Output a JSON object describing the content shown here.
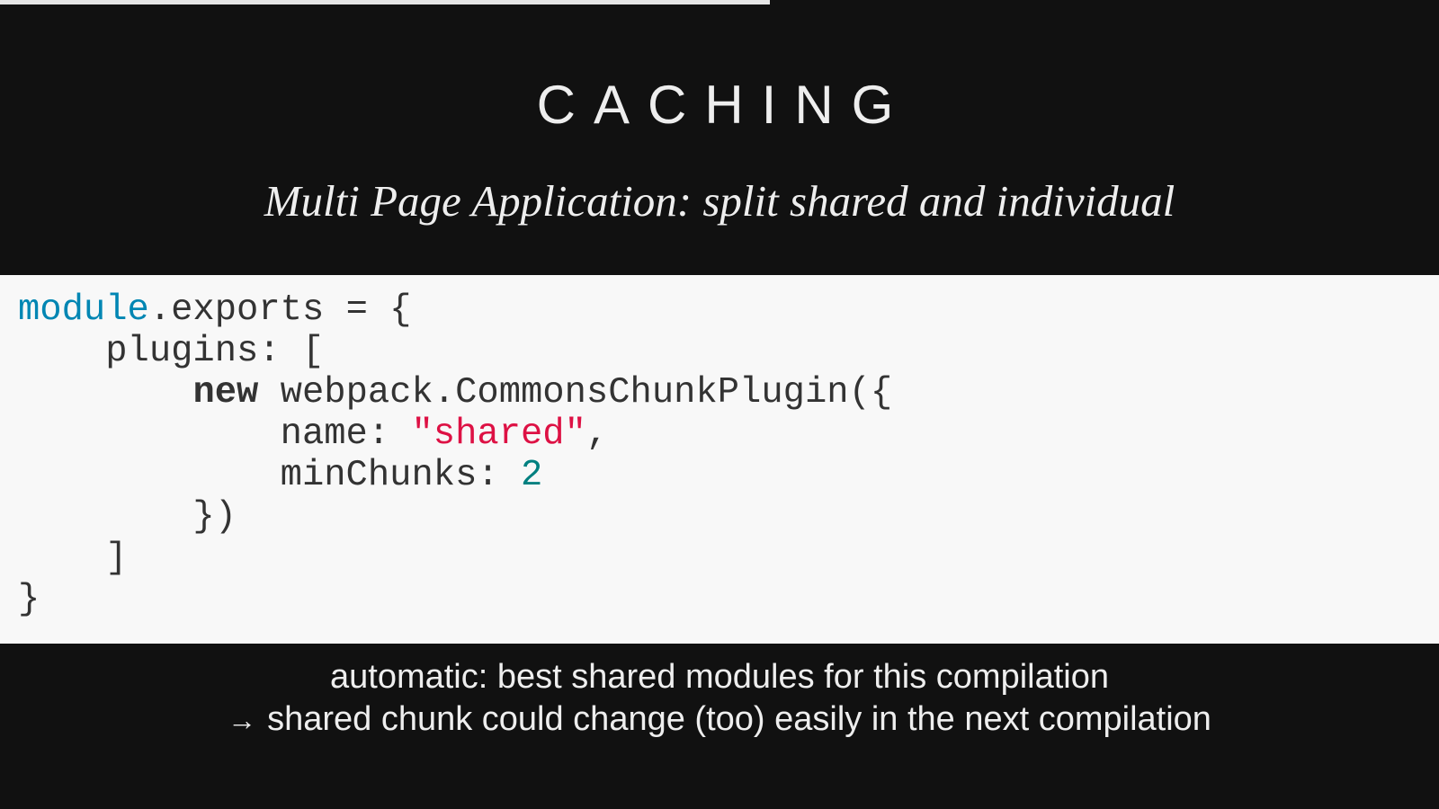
{
  "slide": {
    "title": "CACHING",
    "subtitle": "Multi Page Application: split shared and individual",
    "progress": 0.535
  },
  "code": {
    "line1": {
      "builtin": "module",
      "rest": ".exports = {"
    },
    "line2": "    plugins: [",
    "line3": {
      "indent": "        ",
      "keyword": "new",
      "rest": " webpack.CommonsChunkPlugin({"
    },
    "line4": {
      "prefix": "            name: ",
      "string": "\"shared\"",
      "suffix": ","
    },
    "line5": {
      "prefix": "            minChunks: ",
      "number": "2"
    },
    "line6": "        })",
    "line7": "    ]",
    "line8": "}"
  },
  "notes": {
    "line1": "automatic: best shared modules for this compilation",
    "arrow": "→",
    "line2": "shared chunk could change (too) easily in the next compilation"
  },
  "colors": {
    "background": "#111111",
    "code_background": "#f8f8f8",
    "builtin": "#0086b3",
    "string": "#dd1144",
    "number": "#008080"
  }
}
